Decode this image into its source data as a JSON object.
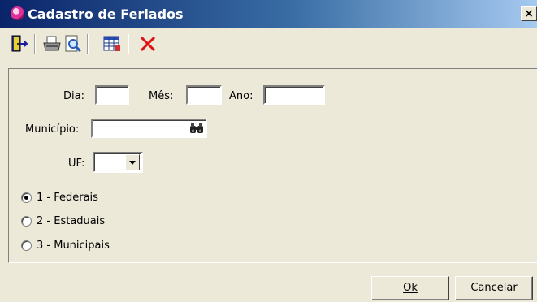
{
  "window": {
    "title": "Cadastro de Feriados",
    "close_label": "×"
  },
  "toolbar": {
    "icons": [
      "exit-door-icon",
      "print-icon",
      "print-preview-icon",
      "grid-icon",
      "delete-icon"
    ]
  },
  "form": {
    "dia_label": "Dia:",
    "dia_value": "",
    "mes_label": "Mês:",
    "mes_value": "",
    "ano_label": "Ano:",
    "ano_value": "",
    "municipio_label": "Município:",
    "municipio_value": "",
    "uf_label": "UF:",
    "uf_value": ""
  },
  "radios": [
    {
      "label": "1 - Federais",
      "checked": true
    },
    {
      "label": "2 - Estaduais",
      "checked": false
    },
    {
      "label": "3 - Municipais",
      "checked": false
    }
  ],
  "buttons": {
    "ok_label": "Ok",
    "cancel_label": "Cancelar"
  }
}
